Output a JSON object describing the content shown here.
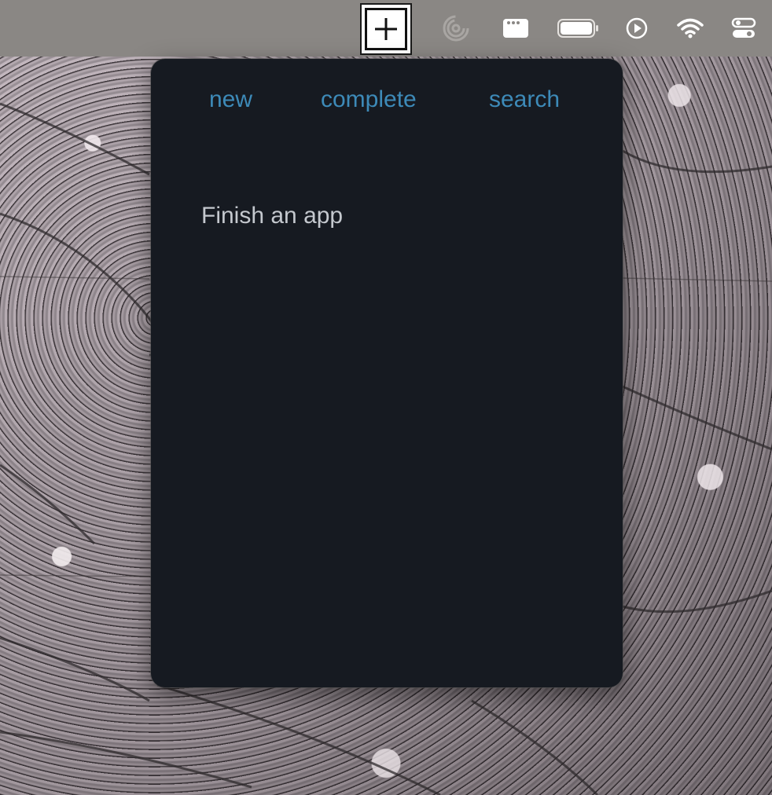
{
  "menubar": {
    "icons": {
      "add": "plus-icon",
      "activity": "activity-rings-icon",
      "window": "window-dots-icon",
      "battery": "battery-icon",
      "play": "play-circle-icon",
      "wifi": "wifi-icon",
      "control_center": "control-center-icon"
    }
  },
  "popover": {
    "tabs": {
      "new": "new",
      "complete": "complete",
      "search": "search"
    },
    "todos": [
      "Finish an app"
    ]
  },
  "colors": {
    "menubar_bg": "#8a8784",
    "popover_bg": "#161a21",
    "link": "#3d8ab8",
    "item_text": "#c4c8ce"
  }
}
